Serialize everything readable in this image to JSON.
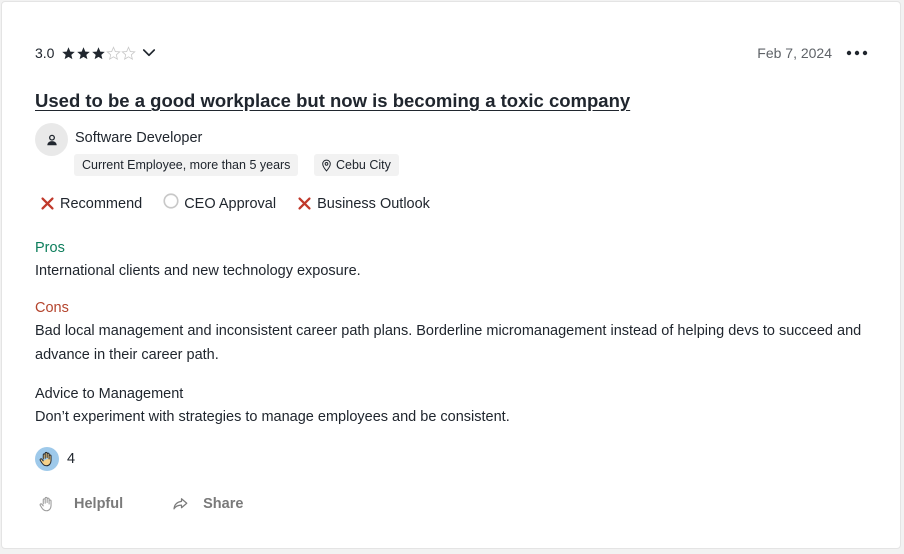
{
  "review": {
    "rating_value": "3.0",
    "rating": 3,
    "rating_max": 5,
    "date": "Feb 7, 2024",
    "title": "Used to be a good workplace but now is becoming a toxic company",
    "job_title": "Software Developer",
    "employment_status": "Current Employee, more than 5 years",
    "location": "Cebu City"
  },
  "flags": [
    {
      "label": "Recommend",
      "state": "negative",
      "icon": "x-icon"
    },
    {
      "label": "CEO Approval",
      "state": "neutral",
      "icon": "circle-icon"
    },
    {
      "label": "Business Outlook",
      "state": "negative",
      "icon": "x-icon"
    }
  ],
  "sections": {
    "pros_label": "Pros",
    "pros_text": "International clients and new technology exposure.",
    "cons_label": "Cons",
    "cons_text": "Bad local management and inconsistent career path plans. Borderline micromanagement instead of helping devs to succeed and advance in their career path.",
    "advice_label": "Advice to Management",
    "advice_text": "Don’t experiment with strategies to manage employees and be consistent."
  },
  "reactions": {
    "icon": "clapping-hands-icon",
    "count": "4"
  },
  "actions": {
    "helpful_label": "Helpful",
    "share_label": "Share"
  },
  "colors": {
    "pros": "#0d7e5c",
    "cons": "#b4442d",
    "x_mark": "#c0392b",
    "reaction_bg": "#9ec9ea"
  }
}
